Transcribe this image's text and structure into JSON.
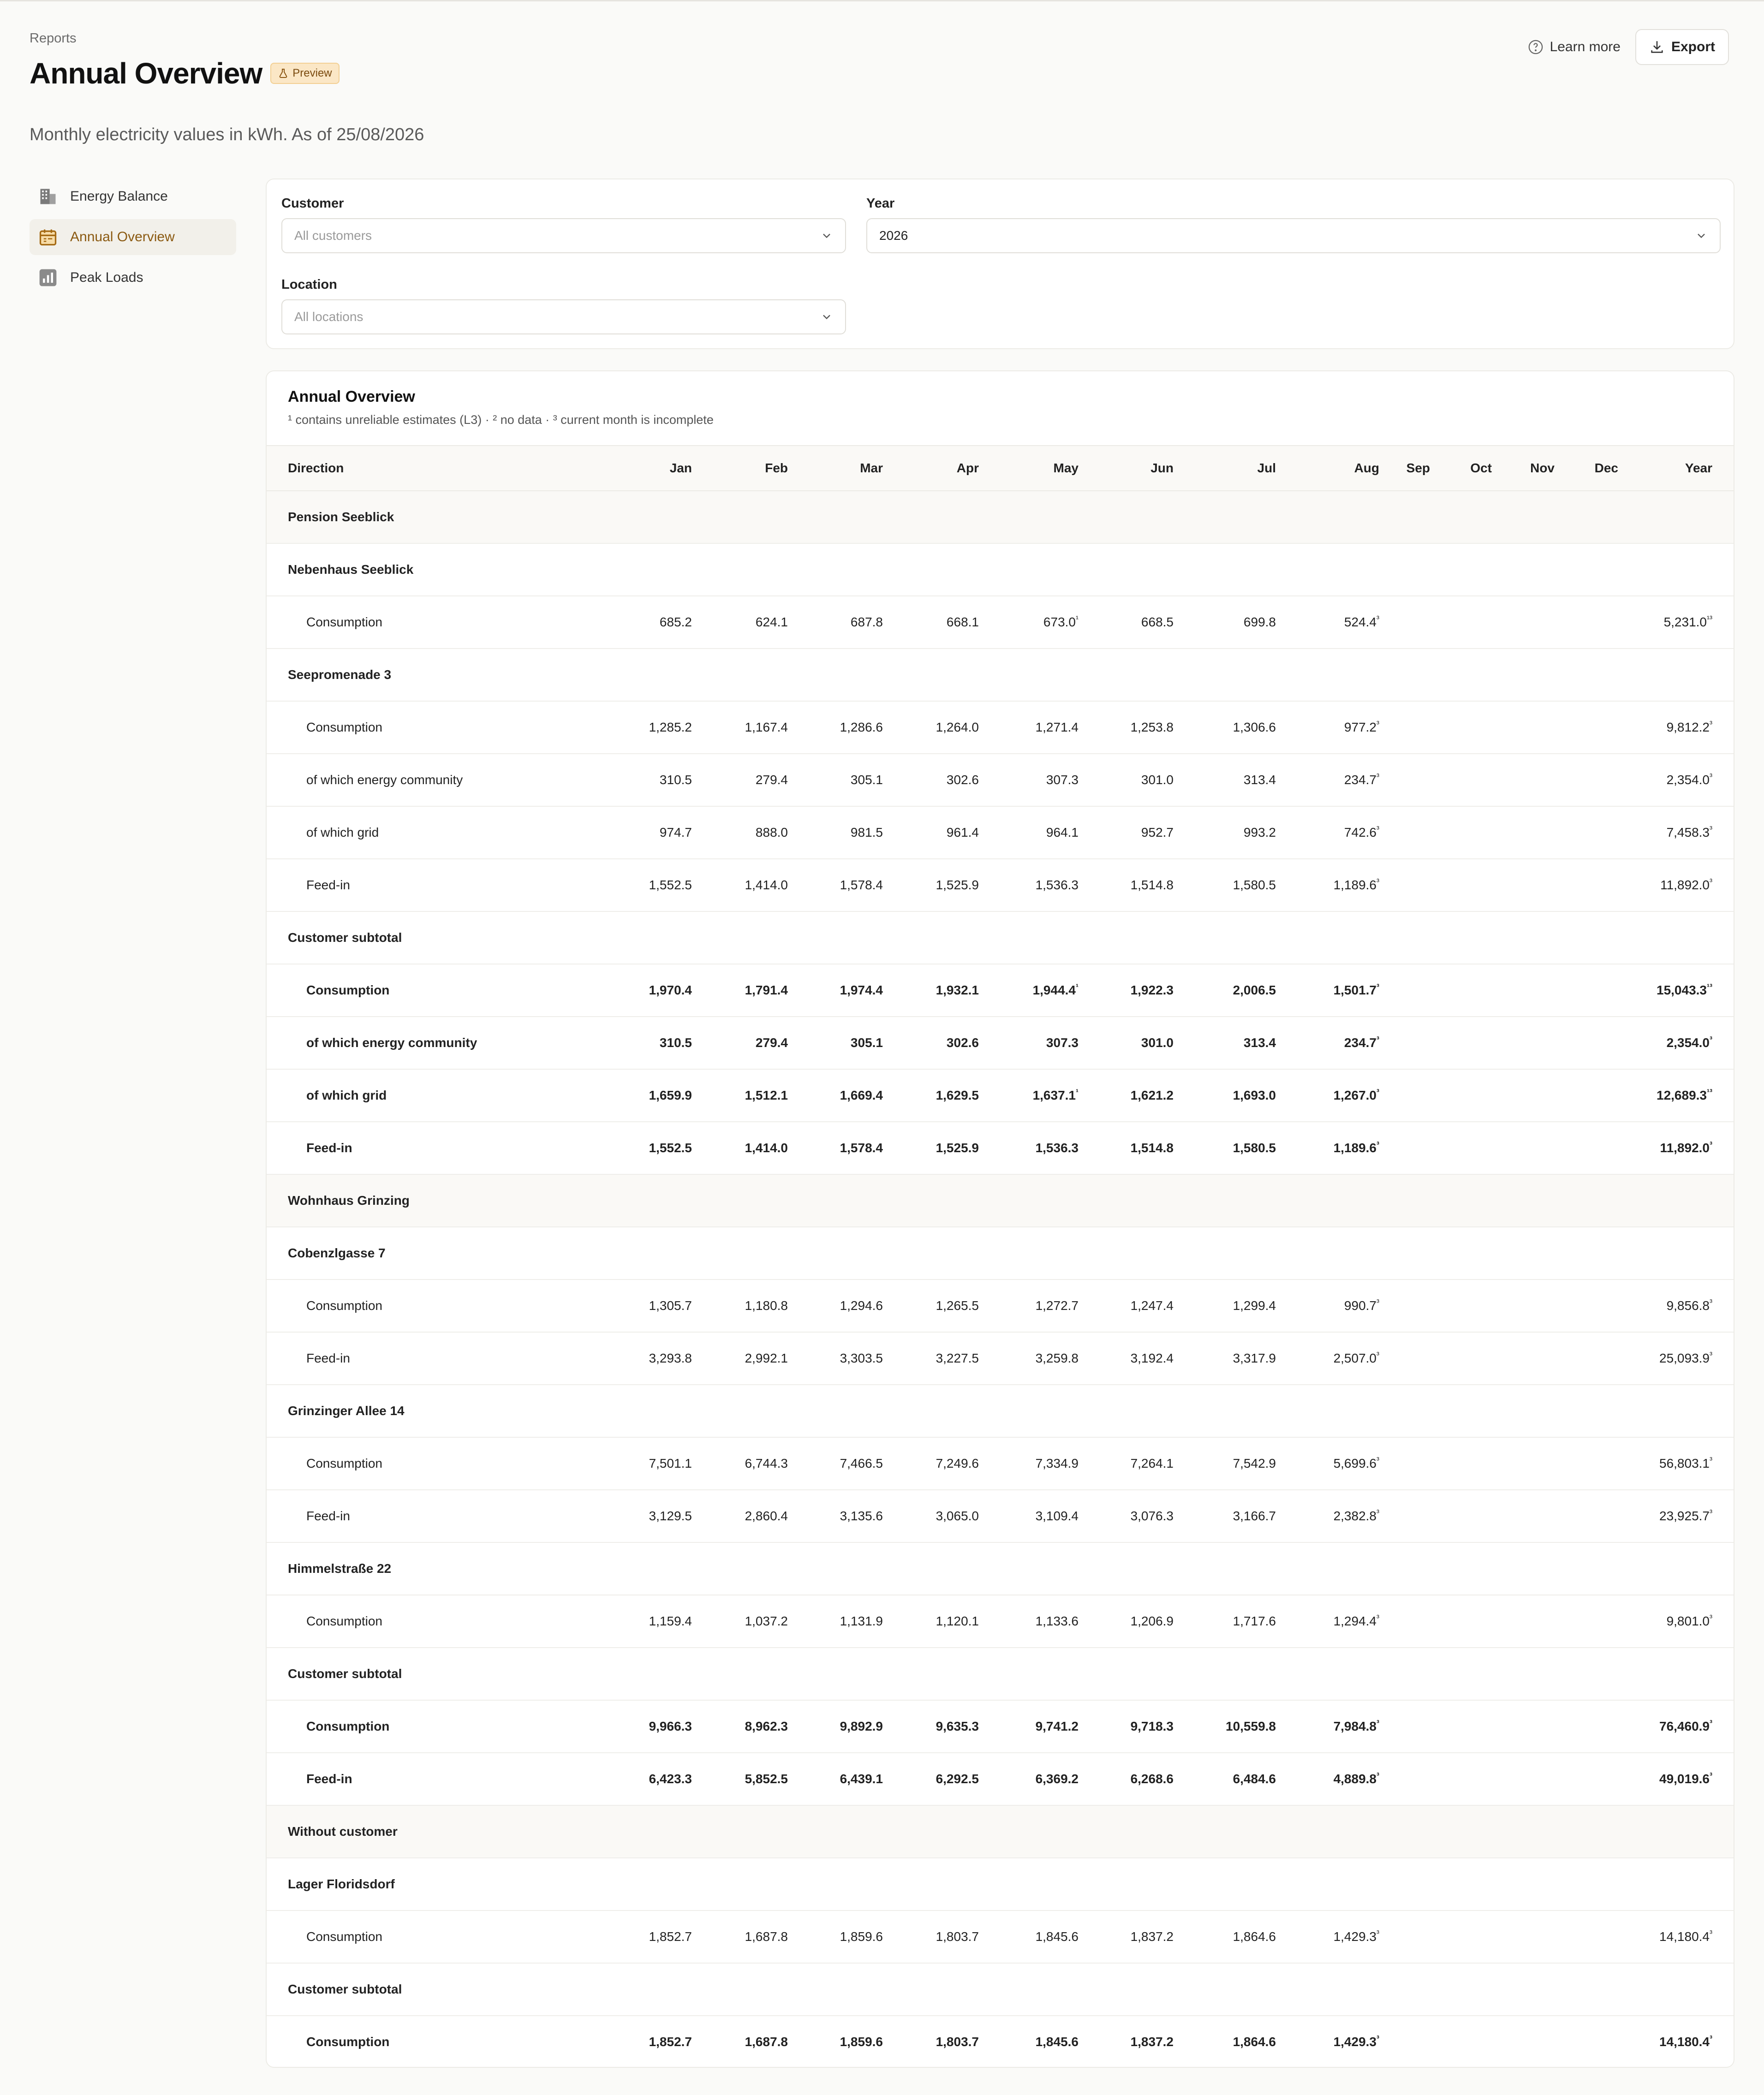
{
  "header": {
    "breadcrumb": "Reports",
    "title": "Annual Overview",
    "badge": "Preview",
    "subtitle": "Monthly electricity values in kWh. As of 25/08/2026"
  },
  "actions": {
    "learn_more": "Learn more",
    "export": "Export"
  },
  "sidebar": {
    "items": [
      {
        "label": "Energy Balance",
        "icon": "building-icon"
      },
      {
        "label": "Annual Overview",
        "icon": "calendar-icon",
        "active": true
      },
      {
        "label": "Peak Loads",
        "icon": "bar-chart-icon"
      }
    ]
  },
  "filters": {
    "customer": {
      "label": "Customer",
      "placeholder": "All customers"
    },
    "year": {
      "label": "Year",
      "value": "2026"
    },
    "location": {
      "label": "Location",
      "placeholder": "All locations"
    }
  },
  "table": {
    "title": "Annual Overview",
    "legend": "¹ contains unreliable estimates (L3) · ² no data · ³ current month is incomplete",
    "columns": [
      "Direction",
      "Jan",
      "Feb",
      "Mar",
      "Apr",
      "May",
      "Jun",
      "Jul",
      "Aug",
      "Sep",
      "Oct",
      "Nov",
      "Dec",
      "Year"
    ],
    "rows": [
      {
        "type": "group",
        "label": "Pension Seeblick"
      },
      {
        "type": "sub",
        "label": "Nebenhaus Seeblick"
      },
      {
        "type": "data",
        "label": "Consumption",
        "values": [
          "685.2",
          "624.1",
          "687.8",
          "668.1",
          "673.0|¹",
          "668.5",
          "699.8",
          "524.4|³",
          "",
          "",
          "",
          "",
          "5,231.0|¹³"
        ]
      },
      {
        "type": "sub",
        "label": "Seepromenade 3"
      },
      {
        "type": "data",
        "label": "Consumption",
        "values": [
          "1,285.2",
          "1,167.4",
          "1,286.6",
          "1,264.0",
          "1,271.4",
          "1,253.8",
          "1,306.6",
          "977.2|³",
          "",
          "",
          "",
          "",
          "9,812.2|³"
        ]
      },
      {
        "type": "data",
        "label": "of which energy community",
        "values": [
          "310.5",
          "279.4",
          "305.1",
          "302.6",
          "307.3",
          "301.0",
          "313.4",
          "234.7|³",
          "",
          "",
          "",
          "",
          "2,354.0|³"
        ]
      },
      {
        "type": "data",
        "label": "of which grid",
        "values": [
          "974.7",
          "888.0",
          "981.5",
          "961.4",
          "964.1",
          "952.7",
          "993.2",
          "742.6|³",
          "",
          "",
          "",
          "",
          "7,458.3|³"
        ]
      },
      {
        "type": "data",
        "label": "Feed-in",
        "values": [
          "1,552.5",
          "1,414.0",
          "1,578.4",
          "1,525.9",
          "1,536.3",
          "1,514.8",
          "1,580.5",
          "1,189.6|³",
          "",
          "",
          "",
          "",
          "11,892.0|³"
        ]
      },
      {
        "type": "sub",
        "label": "Customer subtotal"
      },
      {
        "type": "bold",
        "label": "Consumption",
        "values": [
          "1,970.4",
          "1,791.4",
          "1,974.4",
          "1,932.1",
          "1,944.4|¹",
          "1,922.3",
          "2,006.5",
          "1,501.7|³",
          "",
          "",
          "",
          "",
          "15,043.3|¹³"
        ]
      },
      {
        "type": "bold",
        "label": "of which energy community",
        "values": [
          "310.5",
          "279.4",
          "305.1",
          "302.6",
          "307.3",
          "301.0",
          "313.4",
          "234.7|³",
          "",
          "",
          "",
          "",
          "2,354.0|³"
        ]
      },
      {
        "type": "bold",
        "label": "of which grid",
        "values": [
          "1,659.9",
          "1,512.1",
          "1,669.4",
          "1,629.5",
          "1,637.1|¹",
          "1,621.2",
          "1,693.0",
          "1,267.0|³",
          "",
          "",
          "",
          "",
          "12,689.3|¹³"
        ]
      },
      {
        "type": "bold",
        "label": "Feed-in",
        "values": [
          "1,552.5",
          "1,414.0",
          "1,578.4",
          "1,525.9",
          "1,536.3",
          "1,514.8",
          "1,580.5",
          "1,189.6|³",
          "",
          "",
          "",
          "",
          "11,892.0|³"
        ]
      },
      {
        "type": "group",
        "label": "Wohnhaus Grinzing"
      },
      {
        "type": "sub",
        "label": "Cobenzlgasse 7"
      },
      {
        "type": "data",
        "label": "Consumption",
        "values": [
          "1,305.7",
          "1,180.8",
          "1,294.6",
          "1,265.5",
          "1,272.7",
          "1,247.4",
          "1,299.4",
          "990.7|³",
          "",
          "",
          "",
          "",
          "9,856.8|³"
        ]
      },
      {
        "type": "data",
        "label": "Feed-in",
        "values": [
          "3,293.8",
          "2,992.1",
          "3,303.5",
          "3,227.5",
          "3,259.8",
          "3,192.4",
          "3,317.9",
          "2,507.0|³",
          "",
          "",
          "",
          "",
          "25,093.9|³"
        ]
      },
      {
        "type": "sub",
        "label": "Grinzinger Allee 14"
      },
      {
        "type": "data",
        "label": "Consumption",
        "values": [
          "7,501.1",
          "6,744.3",
          "7,466.5",
          "7,249.6",
          "7,334.9",
          "7,264.1",
          "7,542.9",
          "5,699.6|³",
          "",
          "",
          "",
          "",
          "56,803.1|³"
        ]
      },
      {
        "type": "data",
        "label": "Feed-in",
        "values": [
          "3,129.5",
          "2,860.4",
          "3,135.6",
          "3,065.0",
          "3,109.4",
          "3,076.3",
          "3,166.7",
          "2,382.8|³",
          "",
          "",
          "",
          "",
          "23,925.7|³"
        ]
      },
      {
        "type": "sub",
        "label": "Himmelstraße 22"
      },
      {
        "type": "data",
        "label": "Consumption",
        "values": [
          "1,159.4",
          "1,037.2",
          "1,131.9",
          "1,120.1",
          "1,133.6",
          "1,206.9",
          "1,717.6",
          "1,294.4|³",
          "",
          "",
          "",
          "",
          "9,801.0|³"
        ]
      },
      {
        "type": "sub",
        "label": "Customer subtotal"
      },
      {
        "type": "bold",
        "label": "Consumption",
        "values": [
          "9,966.3",
          "8,962.3",
          "9,892.9",
          "9,635.3",
          "9,741.2",
          "9,718.3",
          "10,559.8",
          "7,984.8|³",
          "",
          "",
          "",
          "",
          "76,460.9|³"
        ]
      },
      {
        "type": "bold",
        "label": "Feed-in",
        "values": [
          "6,423.3",
          "5,852.5",
          "6,439.1",
          "6,292.5",
          "6,369.2",
          "6,268.6",
          "6,484.6",
          "4,889.8|³",
          "",
          "",
          "",
          "",
          "49,019.6|³"
        ]
      },
      {
        "type": "group",
        "label": "Without customer"
      },
      {
        "type": "sub",
        "label": "Lager Floridsdorf"
      },
      {
        "type": "data",
        "label": "Consumption",
        "values": [
          "1,852.7",
          "1,687.8",
          "1,859.6",
          "1,803.7",
          "1,845.6",
          "1,837.2",
          "1,864.6",
          "1,429.3|³",
          "",
          "",
          "",
          "",
          "14,180.4|³"
        ]
      },
      {
        "type": "sub",
        "label": "Customer subtotal"
      },
      {
        "type": "bold",
        "label": "Consumption",
        "values": [
          "1,852.7",
          "1,687.8",
          "1,859.6",
          "1,803.7",
          "1,845.6",
          "1,837.2",
          "1,864.6",
          "1,429.3|³",
          "",
          "",
          "",
          "",
          "14,180.4|³"
        ]
      }
    ]
  }
}
